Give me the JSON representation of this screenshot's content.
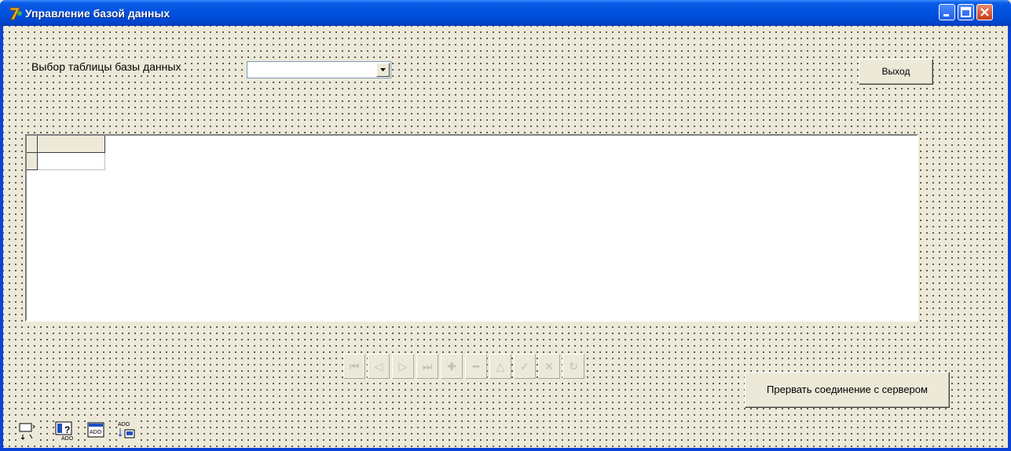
{
  "window": {
    "title": "Управление базой данных"
  },
  "form": {
    "table_select_label": "Выбор таблицы базы данных",
    "table_select_value": "",
    "exit_button": "Выход",
    "disconnect_button": "Прервать соединение с сервером"
  },
  "navigator": {
    "buttons": [
      {
        "name": "first",
        "glyph": "⏮"
      },
      {
        "name": "prior",
        "glyph": "◁"
      },
      {
        "name": "next",
        "glyph": "▷"
      },
      {
        "name": "last",
        "glyph": "⏭"
      },
      {
        "name": "insert",
        "glyph": "✚"
      },
      {
        "name": "delete",
        "glyph": "━"
      },
      {
        "name": "edit",
        "glyph": "△"
      },
      {
        "name": "post",
        "glyph": "✓"
      },
      {
        "name": "cancel",
        "glyph": "✕"
      },
      {
        "name": "refresh",
        "glyph": "↻"
      }
    ]
  },
  "components": [
    "data-source-icon",
    "ado-query-icon",
    "ado-table-icon",
    "ado-connection-icon"
  ],
  "colors": {
    "titlebar": "#0052df",
    "form_bg": "#ece9d8",
    "close": "#c83b16"
  }
}
